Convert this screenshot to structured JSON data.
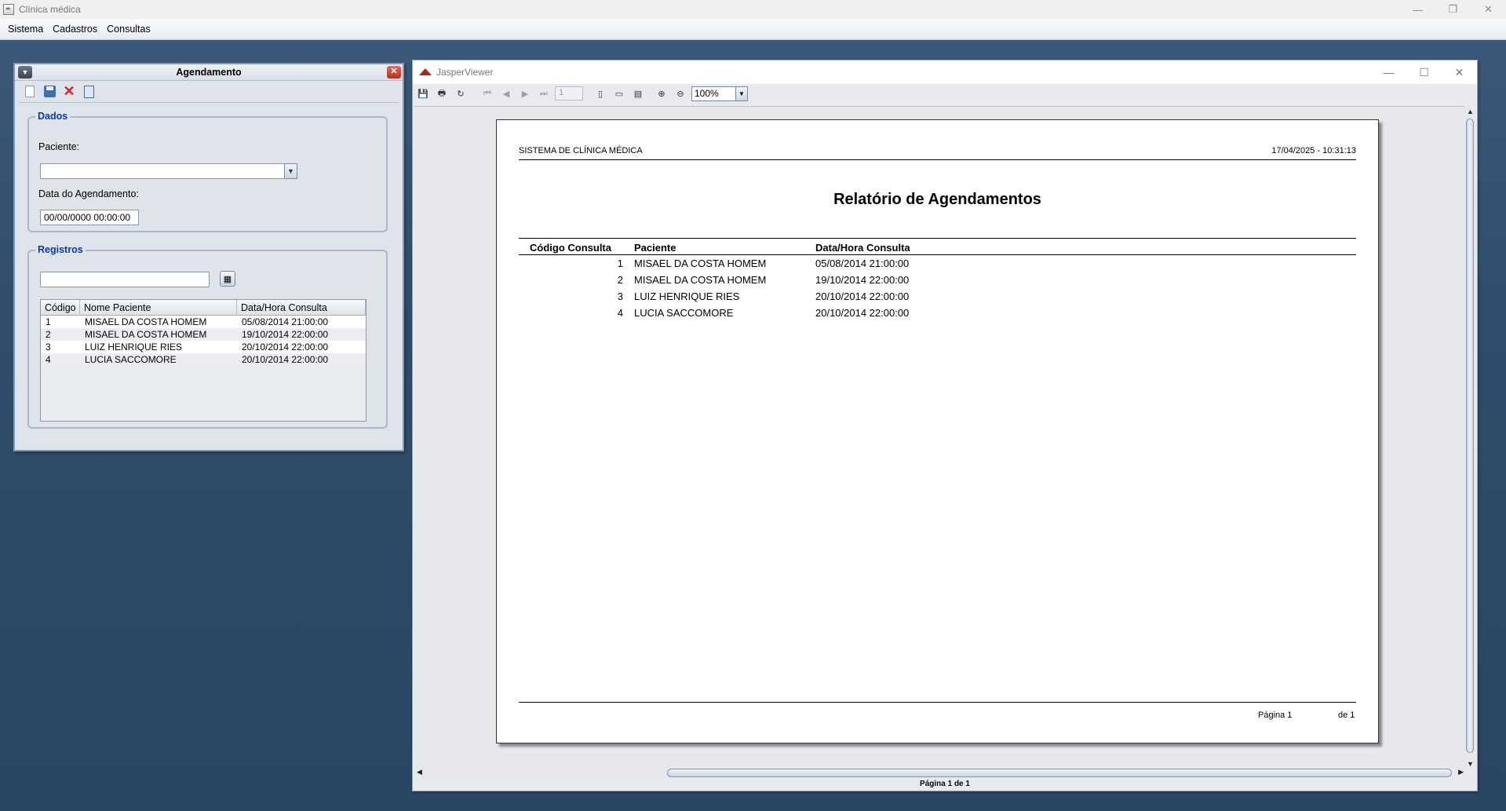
{
  "window": {
    "title": "Clínica médica",
    "controls": [
      "—",
      "❐",
      "✕"
    ]
  },
  "menu": [
    "Sistema",
    "Cadastros",
    "Consultas"
  ],
  "agendamento": {
    "title": "Agendamento",
    "dados_legend": "Dados",
    "paciente_label": "Paciente:",
    "paciente_value": "",
    "data_label": "Data do Agendamento:",
    "data_value": "00/00/0000 00:00:00",
    "registros_legend": "Registros",
    "search_value": "",
    "table": {
      "headers": [
        "Código",
        "Nome Paciente",
        "Data/Hora Consulta"
      ],
      "rows": [
        [
          "1",
          "MISAEL DA COSTA HOMEM",
          "05/08/2014 21:00:00"
        ],
        [
          "2",
          "MISAEL DA COSTA HOMEM",
          "19/10/2014 22:00:00"
        ],
        [
          "3",
          "LUIZ HENRIQUE RIES",
          "20/10/2014 22:00:00"
        ],
        [
          "4",
          "LUCIA SACCOMORE",
          "20/10/2014 22:00:00"
        ]
      ]
    }
  },
  "jasper": {
    "title": "JasperViewer",
    "page_field": "1",
    "zoom": "100%",
    "status": "Página 1 de 1",
    "report": {
      "system": "SISTEMA DE CLÍNICA MÉDICA",
      "datetime": "17/04/2025 - 10:31:13",
      "title": "Relatório de Agendamentos",
      "headers": [
        "Código Consulta",
        "Paciente",
        "Data/Hora Consulta"
      ],
      "rows": [
        [
          "1",
          "MISAEL DA COSTA HOMEM",
          "05/08/2014 21:00:00"
        ],
        [
          "2",
          "MISAEL DA COSTA HOMEM",
          "19/10/2014 22:00:00"
        ],
        [
          "3",
          "LUIZ HENRIQUE RIES",
          "20/10/2014 22:00:00"
        ],
        [
          "4",
          "LUCIA SACCOMORE",
          "20/10/2014 22:00:00"
        ]
      ],
      "footer_page": "Página 1",
      "footer_of": "de 1"
    }
  }
}
